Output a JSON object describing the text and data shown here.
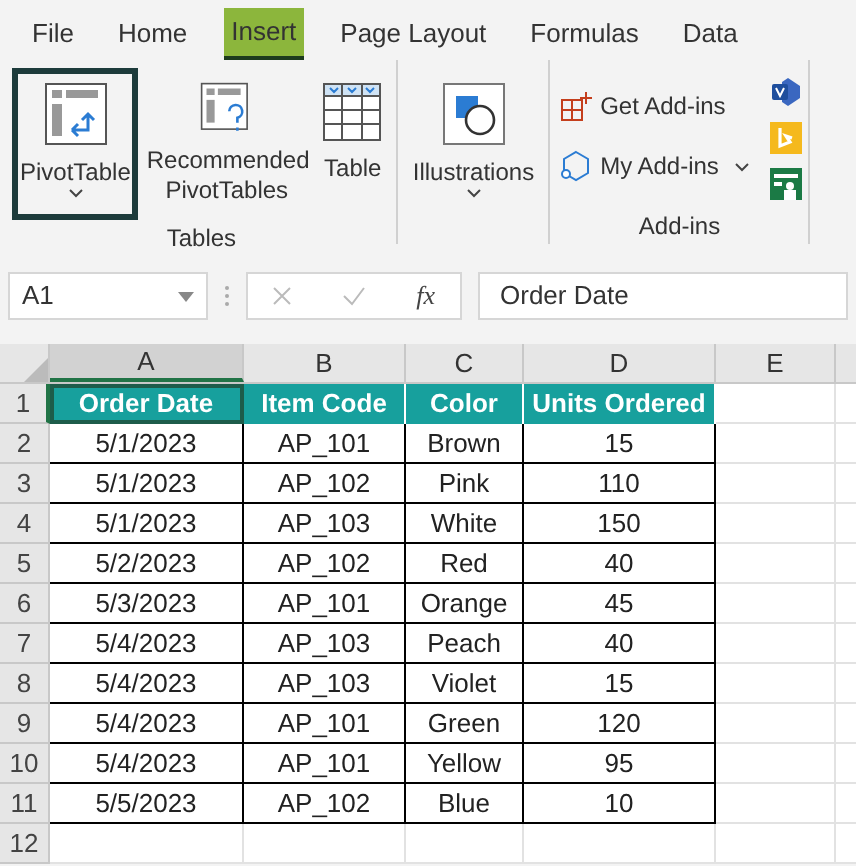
{
  "tabs": [
    {
      "label": "File",
      "selected": false
    },
    {
      "label": "Home",
      "selected": false
    },
    {
      "label": "Insert",
      "selected": true
    },
    {
      "label": "Page Layout",
      "selected": false
    },
    {
      "label": "Formulas",
      "selected": false
    },
    {
      "label": "Data",
      "selected": false
    }
  ],
  "ribbon": {
    "groups": [
      {
        "label": "Tables",
        "buttons": [
          {
            "kind": "pivot",
            "label": "PivotTable",
            "dropdown": true,
            "selected": true
          },
          {
            "kind": "recommended",
            "label": "Recommended PivotTables",
            "dropdown": false,
            "selected": false
          },
          {
            "kind": "table",
            "label": "Table",
            "dropdown": false,
            "selected": false
          }
        ]
      },
      {
        "buttons": [
          {
            "kind": "illustrations",
            "label": "Illustrations",
            "dropdown": true,
            "selected": false
          }
        ]
      },
      {
        "label": "Add-ins",
        "buttons": [
          {
            "kind": "get-addins",
            "label": "Get Add-ins",
            "dropdown": false,
            "selected": false
          },
          {
            "kind": "my-addins",
            "label": "My Add-ins",
            "dropdown": true,
            "selected": false
          }
        ],
        "icons": [
          {
            "kind": "visio"
          },
          {
            "kind": "bing"
          },
          {
            "kind": "people"
          }
        ]
      }
    ]
  },
  "formula_bar": {
    "name_box": "A1",
    "fx": "fx",
    "formula": "Order Date"
  },
  "sheet": {
    "columns": [
      {
        "label": "A",
        "selected": true
      },
      {
        "label": "B",
        "selected": false
      },
      {
        "label": "C",
        "selected": false
      },
      {
        "label": "D",
        "selected": false
      },
      {
        "label": "E",
        "selected": false
      }
    ],
    "row_headers": [
      {
        "label": "1",
        "selected": true
      },
      {
        "label": "2",
        "selected": false
      },
      {
        "label": "3",
        "selected": false
      },
      {
        "label": "4",
        "selected": false
      },
      {
        "label": "5",
        "selected": false
      },
      {
        "label": "6",
        "selected": false
      },
      {
        "label": "7",
        "selected": false
      },
      {
        "label": "8",
        "selected": false
      },
      {
        "label": "9",
        "selected": false
      },
      {
        "label": "10",
        "selected": false
      },
      {
        "label": "11",
        "selected": false
      },
      {
        "label": "12",
        "selected": false
      }
    ],
    "table": {
      "header": [
        "Order Date",
        "Item Code",
        "Color",
        "Units Ordered"
      ],
      "rows": [
        [
          "5/1/2023",
          "AP_101",
          "Brown",
          "15"
        ],
        [
          "5/1/2023",
          "AP_102",
          "Pink",
          "110"
        ],
        [
          "5/1/2023",
          "AP_103",
          "White",
          "150"
        ],
        [
          "5/2/2023",
          "AP_102",
          "Red",
          "40"
        ],
        [
          "5/3/2023",
          "AP_101",
          "Orange",
          "45"
        ],
        [
          "5/4/2023",
          "AP_103",
          "Peach",
          "40"
        ],
        [
          "5/4/2023",
          "AP_103",
          "Violet",
          "15"
        ],
        [
          "5/4/2023",
          "AP_101",
          "Green",
          "120"
        ],
        [
          "5/4/2023",
          "AP_101",
          "Yellow",
          "95"
        ],
        [
          "5/5/2023",
          "AP_102",
          "Blue",
          "10"
        ]
      ]
    }
  }
}
